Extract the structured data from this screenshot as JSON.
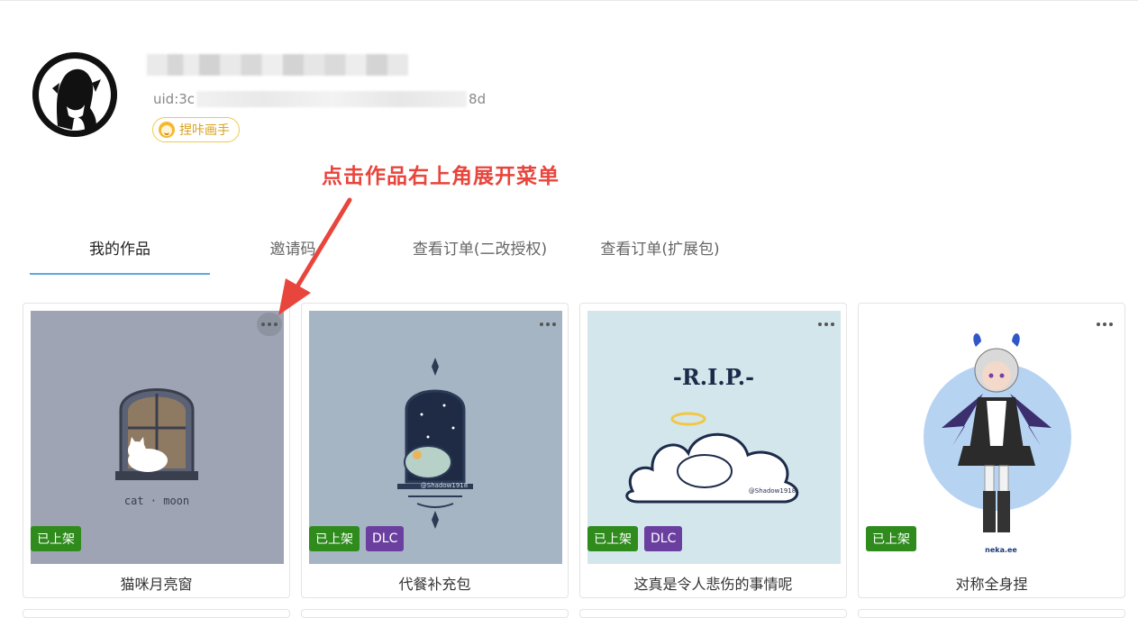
{
  "profile": {
    "uid_prefix": "uid:3c",
    "uid_suffix": "8d",
    "badge_label": "捏咔画手"
  },
  "annotation": {
    "text": "点击作品右上角展开菜单",
    "color": "#e8453c"
  },
  "tabs": [
    {
      "label": "我的作品",
      "active": true
    },
    {
      "label": "邀请码",
      "active": false
    },
    {
      "label": "查看订单(二改授权)",
      "active": false
    },
    {
      "label": "查看订单(扩展包)",
      "active": false
    }
  ],
  "works": [
    {
      "title": "猫咪月亮窗",
      "tags": [
        "已上架"
      ],
      "thumb_bg": "#9ea4b4",
      "art_text": "cat · moon"
    },
    {
      "title": "代餐补充包",
      "tags": [
        "已上架",
        "DLC"
      ],
      "thumb_bg": "#a6b5c3",
      "art_text": "@Shadow1918"
    },
    {
      "title": "这真是令人悲伤的事情呢",
      "tags": [
        "已上架",
        "DLC"
      ],
      "thumb_bg": "#d3e6ec",
      "art_text": "-R.I.P.-",
      "art_sign": "@Shadow1918"
    },
    {
      "title": "对称全身捏",
      "tags": [
        "已上架"
      ],
      "thumb_bg": "#ffffff",
      "art_text": "neka.ee"
    }
  ],
  "colors": {
    "tag_listed": "#2e8b1c",
    "tag_dlc": "#6b3fa0",
    "tab_underline": "#5aa9e6",
    "badge": "#f2c94c"
  }
}
